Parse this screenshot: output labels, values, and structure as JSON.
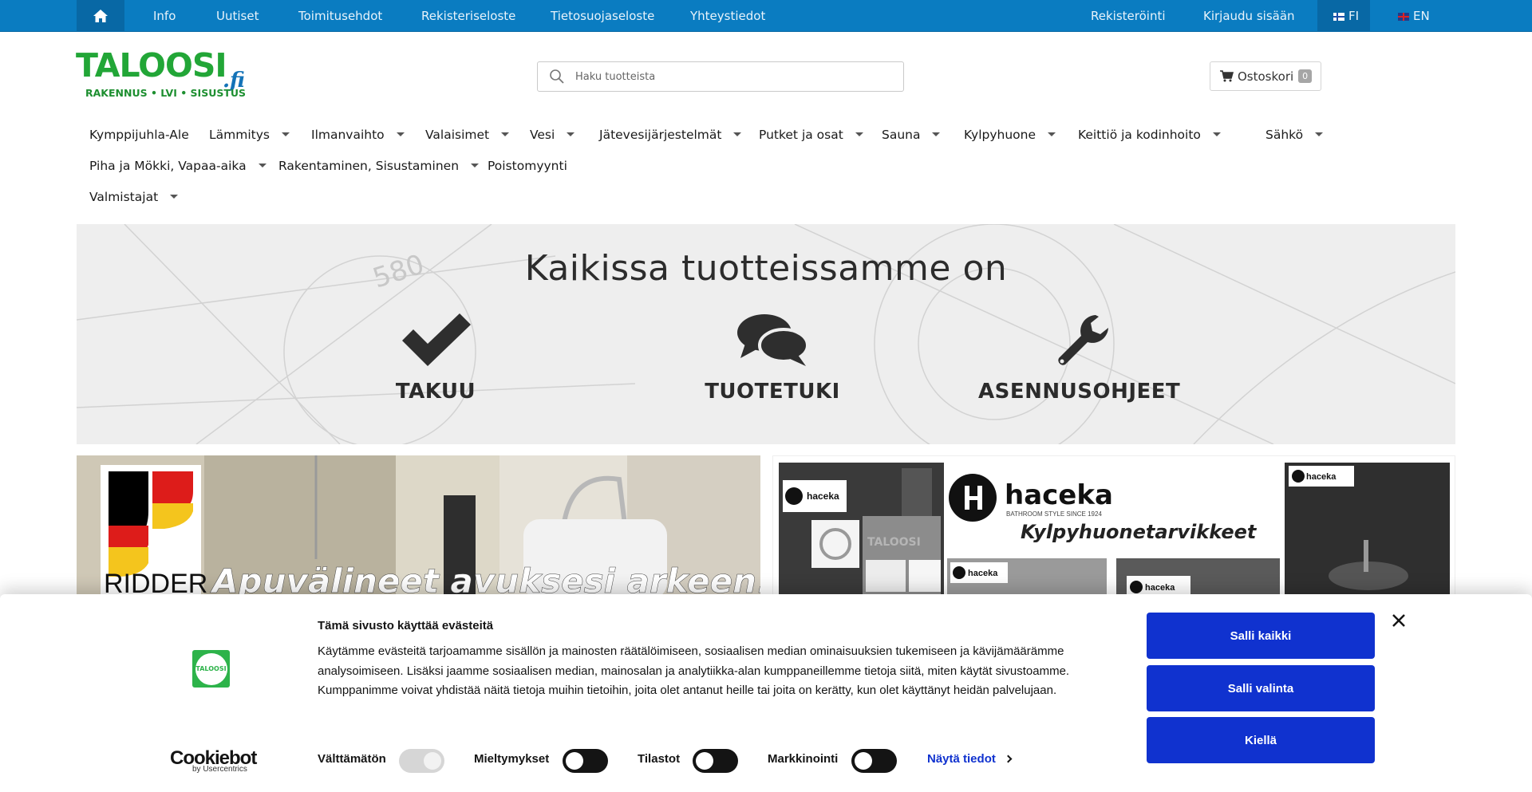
{
  "topbar": {
    "links": [
      "Info",
      "Uutiset",
      "Toimitusehdot",
      "Rekisteriseloste",
      "Tietosuojaseloste",
      "Yhteystiedot"
    ],
    "register": "Rekisteröinti",
    "login": "Kirjaudu sisään",
    "lang_fi": "FI",
    "lang_en": "EN"
  },
  "header": {
    "logo_main": "TALOOSI",
    "logo_suffix": ".fi",
    "logo_tagline": "RAKENNUS • LVI • SISUSTUS",
    "search_placeholder": "Haku tuotteista",
    "cart_label": "Ostoskori",
    "cart_count": "0"
  },
  "categories": [
    {
      "label": "Kymppijuhla-Ale",
      "dropdown": false
    },
    {
      "label": "Lämmitys",
      "dropdown": true
    },
    {
      "label": "Ilmanvaihto",
      "dropdown": true
    },
    {
      "label": "Valaisimet",
      "dropdown": true
    },
    {
      "label": "Vesi",
      "dropdown": true
    },
    {
      "label": "Jätevesijärjestelmät",
      "dropdown": true
    },
    {
      "label": "Putket ja osat",
      "dropdown": true
    },
    {
      "label": "Sauna",
      "dropdown": true
    },
    {
      "label": "Kylpyhuone",
      "dropdown": true
    },
    {
      "label": "Keittiö ja kodinhoito",
      "dropdown": true
    },
    {
      "label": "Sähkö",
      "dropdown": true
    },
    {
      "label": "Piha ja Mökki, Vapaa-aika",
      "dropdown": true
    },
    {
      "label": "Rakentaminen, Sisustaminen",
      "dropdown": true
    },
    {
      "label": "Poistomyynti",
      "dropdown": false
    },
    {
      "label": "Valmistajat",
      "dropdown": true
    }
  ],
  "hero": {
    "title": "Kaikissa  tuotteissamme on",
    "features": [
      {
        "label": "TAKUU",
        "icon": "check-icon"
      },
      {
        "label": "TUOTETUKI",
        "icon": "chat-bubbles-icon"
      },
      {
        "label": "ASENNUSOHJEET",
        "icon": "wrench-icon"
      }
    ],
    "drawing_number": "580"
  },
  "promo_left": {
    "brand": "RIDDER",
    "slogan": "Apuvälineet avuksesi arkeen!"
  },
  "promo_right": {
    "brand": "haceka",
    "brand_tagline": "BATHROOM STYLE SINCE 1924",
    "headline": "Kylpyhuonetarvikkeet",
    "tile_brand": "haceka",
    "tile_watermark": "TALOOSI"
  },
  "cookie": {
    "title": "Tämä sivusto käyttää evästeitä",
    "text": "Käytämme evästeitä tarjoamamme sisällön ja mainosten räätälöimiseen, sosiaalisen median ominaisuuksien tukemiseen ja kävijämäärämme analysoimiseen. Lisäksi jaamme sosiaalisen median, mainosalan ja analytiikka-alan kumppaneillemme tietoja siitä, miten käytät sivustoamme. Kumppanimme voivat yhdistää näitä tietoja muihin tietoihin, joita olet antanut heille tai joita on kerätty, kun olet käyttänyt heidän palvelujaan.",
    "logo_text": "TALOOSI",
    "brand": "Cookiebot",
    "brand_sub": "by Usercentrics",
    "toggles": [
      {
        "label": "Välttämätön",
        "enabled": true,
        "disabled": true
      },
      {
        "label": "Mieltymykset",
        "enabled": false,
        "disabled": false
      },
      {
        "label": "Tilastot",
        "enabled": false,
        "disabled": false
      },
      {
        "label": "Markkinointi",
        "enabled": false,
        "disabled": false
      }
    ],
    "details_link": "Näytä tiedot",
    "buttons": [
      "Salli kaikki",
      "Salli valinta",
      "Kiellä"
    ],
    "accent_color": "#1032cf"
  }
}
